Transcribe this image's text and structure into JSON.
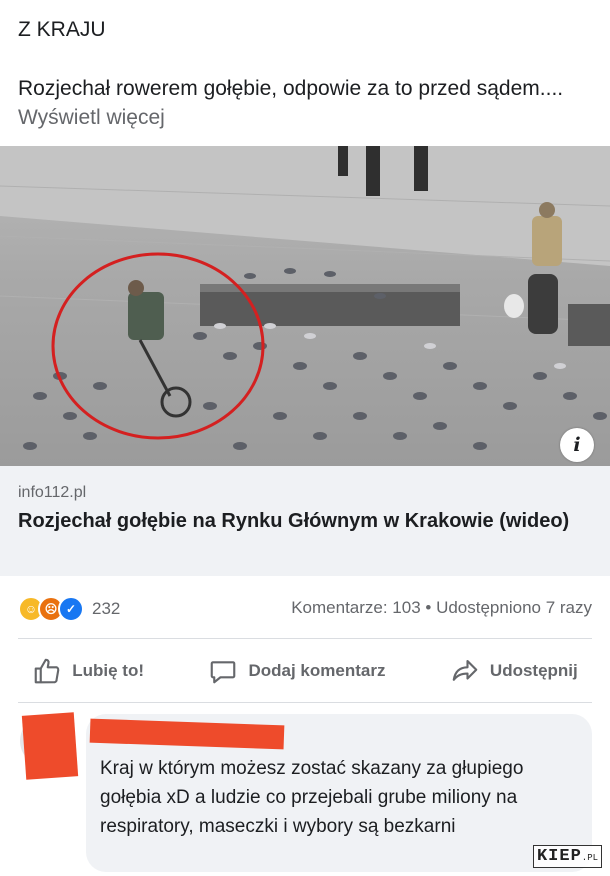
{
  "post": {
    "section_label": "Z KRAJU",
    "text": "Rozjechał rowerem gołębie, odpowie za to przed sądem....",
    "see_more": "Wyświetl więcej"
  },
  "link": {
    "domain": "info112.pl",
    "title": "Rozjechał gołębie na Rynku Głównym w Krakowie (wideo)"
  },
  "info_button": "i",
  "stats": {
    "reaction_icons": [
      "haha-icon",
      "angry-icon",
      "like-icon"
    ],
    "reaction_count": "232",
    "comments_shares": "Komentarze: 103 • Udostępniono 7 razy"
  },
  "actions": {
    "like": "Lubię to!",
    "comment": "Dodaj komentarz",
    "share": "Udostępnij"
  },
  "comment": {
    "text": "Kraj w którym możesz zostać skazany za głupiego gołębia xD a ludzie co przejebali grube miliony na respiratory, maseczki i wybory są bezkarni"
  },
  "watermark": {
    "main": "KIEP",
    "suffix": ".PL"
  },
  "colors": {
    "redaction": "#ee4b2b",
    "circle": "#d42020",
    "link_bg": "#f0f2f5",
    "muted_text": "#65676b"
  }
}
